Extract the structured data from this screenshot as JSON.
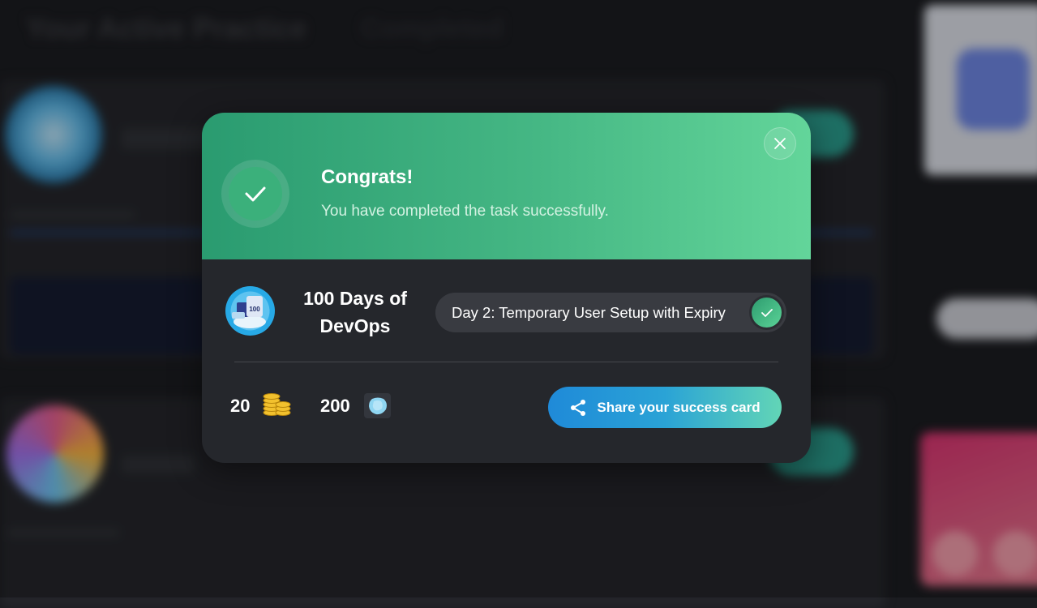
{
  "background": {
    "page_title": "Your Active Practice",
    "tab_completed": "Completed"
  },
  "modal": {
    "title": "Congrats!",
    "subtitle": "You have completed the task successfully.",
    "course_title": "100 Days of DevOps",
    "task_label": "Day 2: Temporary User Setup with Expiry",
    "coins": "20",
    "gems": "200",
    "share_label": "Share your success card",
    "icons": {
      "success": "check-icon",
      "close": "close-icon",
      "task_done": "check-icon",
      "coins": "coins-icon",
      "gems": "gem-icon",
      "share": "share-icon"
    },
    "colors": {
      "header_start": "#2a9b70",
      "header_end": "#63d59a",
      "body": "#25272c",
      "share_start": "#1f8ad8",
      "share_end": "#62d5b6"
    }
  }
}
